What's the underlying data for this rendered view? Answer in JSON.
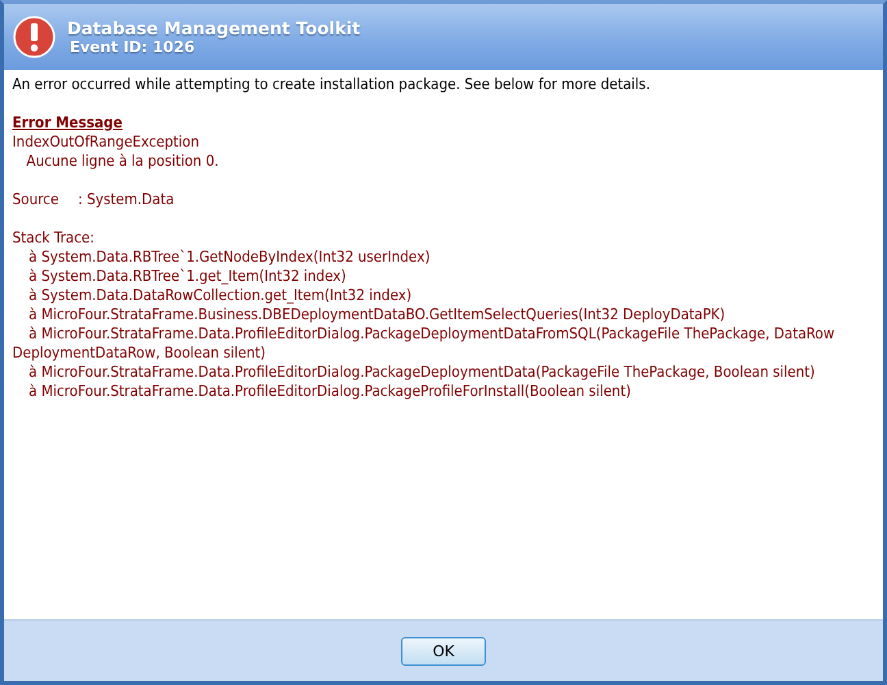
{
  "window": {
    "title": "Database Management Toolkit",
    "subtitle": "Event ID: 1026"
  },
  "summary": "An error occurred while attempting to create installation package. See below for more details.",
  "error": {
    "heading": "Error Message",
    "type": "IndexOutOfRangeException",
    "message": "Aucune ligne à la position 0.",
    "source_label": "Source",
    "source_value": ": System.Data",
    "stack_label": "Stack Trace:",
    "stack": [
      "à System.Data.RBTree`1.GetNodeByIndex(Int32 userIndex)",
      "à System.Data.RBTree`1.get_Item(Int32 index)",
      "à System.Data.DataRowCollection.get_Item(Int32 index)",
      "à MicroFour.StrataFrame.Business.DBEDeploymentDataBO.GetItemSelectQueries(Int32 DeployDataPK)",
      "à MicroFour.StrataFrame.Data.ProfileEditorDialog.PackageDeploymentDataFromSQL(PackageFile ThePackage, DataRow DeploymentDataRow, Boolean silent)",
      "à MicroFour.StrataFrame.Data.ProfileEditorDialog.PackageDeploymentData(PackageFile ThePackage, Boolean silent)",
      "à MicroFour.StrataFrame.Data.ProfileEditorDialog.PackageProfileForInstall(Boolean silent)"
    ]
  },
  "buttons": [
    "OK"
  ]
}
